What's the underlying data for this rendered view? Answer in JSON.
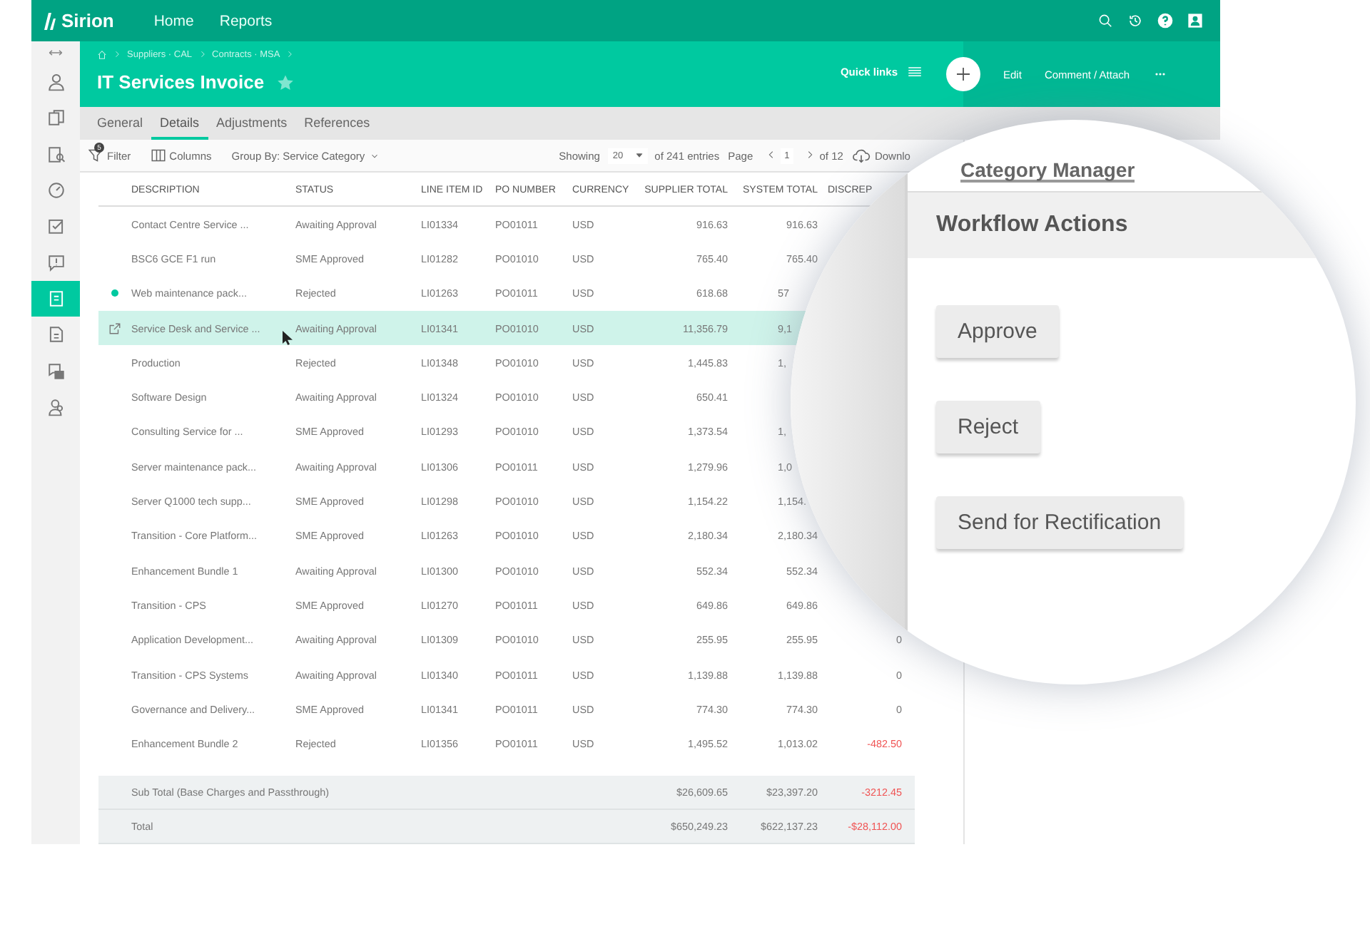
{
  "top_nav": {
    "logo": "Sirion",
    "links": [
      "Home",
      "Reports"
    ]
  },
  "sidebar": {
    "items": [
      {
        "selected": false
      },
      {
        "selected": false
      },
      {
        "selected": false
      },
      {
        "selected": false
      },
      {
        "selected": false
      },
      {
        "selected": false
      },
      {
        "selected": true
      },
      {
        "selected": false
      },
      {
        "selected": false
      },
      {
        "selected": false
      }
    ]
  },
  "header": {
    "breadcrumb": [
      "Suppliers · CAL",
      "Contracts · MSA"
    ],
    "title": "IT Services Invoice",
    "starred": true,
    "quick_links": "Quick links",
    "actions": [
      "Edit",
      "Comment / Attach"
    ]
  },
  "tabs": [
    {
      "label": "General",
      "selected": false
    },
    {
      "label": "Details",
      "selected": true
    },
    {
      "label": "Adjustments",
      "selected": false
    },
    {
      "label": "References",
      "selected": false
    }
  ],
  "toolbar": {
    "filter": "Filter",
    "filter_badge": "5",
    "columns": "Columns",
    "group_by": "Group By: Service Category",
    "showing": "Showing",
    "page_size": "20",
    "entries": "of 241 entries",
    "page_label": "Page",
    "page": "1",
    "page_total": "of 12",
    "download": "Downlo"
  },
  "table": {
    "columns": [
      "DESCRIPTION",
      "STATUS",
      "LINE ITEM ID",
      "PO NUMBER",
      "CURRENCY",
      "SUPPLIER TOTAL",
      "SYSTEM TOTAL",
      "DISCREP"
    ],
    "rows": [
      {
        "selected": false,
        "description": "Contact Centre Service ...",
        "status": "Awaiting Approval",
        "line_item_id": "LI01334",
        "po_number": "PO01011",
        "currency": "USD",
        "supplier_total": "916.63",
        "system_total": "916.63"
      },
      {
        "selected": false,
        "description": "BSC6 GCE F1 run",
        "status": "SME Approved",
        "line_item_id": "LI01282",
        "po_number": "PO01010",
        "currency": "USD",
        "supplier_total": "765.40",
        "system_total": "765.40"
      },
      {
        "selected": false,
        "flagged": true,
        "description": "Web maintenance pack...",
        "status": "Rejected",
        "line_item_id": "LI01263",
        "po_number": "PO01011",
        "currency": "USD",
        "supplier_total": "618.68",
        "system_total": "57",
        "system_total_cut": true
      },
      {
        "selected": true,
        "description": "Service Desk and Service ...",
        "status": "Awaiting Approval",
        "line_item_id": "LI01341",
        "po_number": "PO01010",
        "currency": "USD",
        "supplier_total": "11,356.79",
        "system_total": "9,1",
        "system_total_cut": true
      },
      {
        "selected": false,
        "description": "Production",
        "status": "Rejected",
        "line_item_id": "LI01348",
        "po_number": "PO01010",
        "currency": "USD",
        "supplier_total": "1,445.83",
        "system_total": "1,",
        "system_total_cut": true
      },
      {
        "selected": false,
        "description": "Software Design",
        "status": "Awaiting Approval",
        "line_item_id": "LI01324",
        "po_number": "PO01010",
        "currency": "USD",
        "supplier_total": "650.41"
      },
      {
        "selected": false,
        "description": "Consulting Service for ...",
        "status": "SME Approved",
        "line_item_id": "LI01293",
        "po_number": "PO01010",
        "currency": "USD",
        "supplier_total": "1,373.54",
        "system_total": "1,",
        "system_total_cut": true
      },
      {
        "selected": false,
        "description": "Server maintenance pack...",
        "status": "Awaiting Approval",
        "line_item_id": "LI01306",
        "po_number": "PO01011",
        "currency": "USD",
        "supplier_total": "1,279.96",
        "system_total": "1,0",
        "system_total_cut": true
      },
      {
        "selected": false,
        "description": "Server Q1000 tech supp...",
        "status": "SME Approved",
        "line_item_id": "LI01298",
        "po_number": "PO01010",
        "currency": "USD",
        "supplier_total": "1,154.22",
        "system_total": "1,154.",
        "system_total_cut": true
      },
      {
        "selected": false,
        "description": "Transition - Core Platform...",
        "status": "SME Approved",
        "line_item_id": "LI01263",
        "po_number": "PO01010",
        "currency": "USD",
        "supplier_total": "2,180.34",
        "system_total": "2,180.34"
      },
      {
        "selected": false,
        "description": "Enhancement Bundle 1",
        "status": "Awaiting Approval",
        "line_item_id": "LI01300",
        "po_number": "PO01010",
        "currency": "USD",
        "supplier_total": "552.34",
        "system_total": "552.34"
      },
      {
        "selected": false,
        "description": "Transition - CPS",
        "status": "SME Approved",
        "line_item_id": "LI01270",
        "po_number": "PO01011",
        "currency": "USD",
        "supplier_total": "649.86",
        "system_total": "649.86"
      },
      {
        "selected": false,
        "description": "Application Development...",
        "status": "Awaiting Approval",
        "line_item_id": "LI01309",
        "po_number": "PO01010",
        "currency": "USD",
        "supplier_total": "255.95",
        "system_total": "255.95",
        "discrepancy": "0",
        "negative": false
      },
      {
        "selected": false,
        "description": "Transition - CPS Systems",
        "status": "Awaiting Approval",
        "line_item_id": "LI01340",
        "po_number": "PO01011",
        "currency": "USD",
        "supplier_total": "1,139.88",
        "system_total": "1,139.88",
        "discrepancy": "0",
        "negative": false
      },
      {
        "selected": false,
        "description": "Governance and Delivery...",
        "status": "SME Approved",
        "line_item_id": "LI01341",
        "po_number": "PO01011",
        "currency": "USD",
        "supplier_total": "774.30",
        "system_total": "774.30",
        "discrepancy": "0",
        "negative": false
      },
      {
        "selected": false,
        "description": "Enhancement Bundle 2",
        "status": "Rejected",
        "line_item_id": "LI01356",
        "po_number": "PO01011",
        "currency": "USD",
        "supplier_total": "1,495.52",
        "system_total": "1,013.02",
        "discrepancy": "-482.50",
        "negative": true
      }
    ],
    "totals": [
      {
        "label": "Sub Total (Base Charges and Passthrough)",
        "supplier_total": "$26,609.65",
        "system_total": "$23,397.20",
        "discrepancy": "-3212.45",
        "negative": true
      },
      {
        "label": "Total",
        "supplier_total": "$650,249.23",
        "system_total": "$622,137.23",
        "discrepancy": "-$28,112.00",
        "negative": true
      }
    ]
  },
  "panel": {
    "heading": "Category Manager",
    "section": "Workflow Actions",
    "buttons": [
      "Approve",
      "Reject",
      "Send for Rectification"
    ]
  }
}
